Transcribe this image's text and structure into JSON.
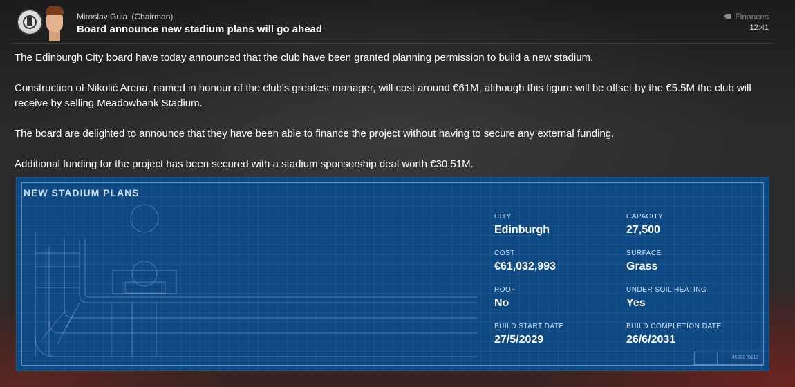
{
  "header": {
    "sender_name": "Miroslav Gula",
    "sender_role": "(Chairman)",
    "subject": "Board announce new stadium plans will go ahead",
    "category": "Finances",
    "time": "12:41"
  },
  "message": {
    "paragraphs": [
      "The Edinburgh City board have today announced that the club have been granted planning permission to build a new stadium.",
      "Construction of Nikolić Arena, named in honour of the club's greatest manager, will cost around €61M, although this figure will be offset by the €5.5M the club will receive by selling Meadowbank Stadium.",
      "The board are delighted to announce that they have been able to finance the project without having to secure any external funding.",
      "Additional funding for the project has been secured with a stadium sponsorship deal worth €30.51M."
    ]
  },
  "panel": {
    "title": "NEW STADIUM PLANS",
    "reference": "45588 /0112",
    "stats": {
      "city": {
        "label": "CITY",
        "value": "Edinburgh"
      },
      "capacity": {
        "label": "CAPACITY",
        "value": "27,500"
      },
      "cost": {
        "label": "COST",
        "value": "€61,032,993"
      },
      "surface": {
        "label": "SURFACE",
        "value": "Grass"
      },
      "roof": {
        "label": "ROOF",
        "value": "No"
      },
      "heating": {
        "label": "UNDER SOIL HEATING",
        "value": "Yes"
      },
      "start": {
        "label": "BUILD START DATE",
        "value": "27/5/2029"
      },
      "completion": {
        "label": "BUILD COMPLETION DATE",
        "value": "26/6/2031"
      }
    }
  },
  "colors": {
    "panel_blue": "#0f4983",
    "panel_label": "#cfe0f2"
  }
}
